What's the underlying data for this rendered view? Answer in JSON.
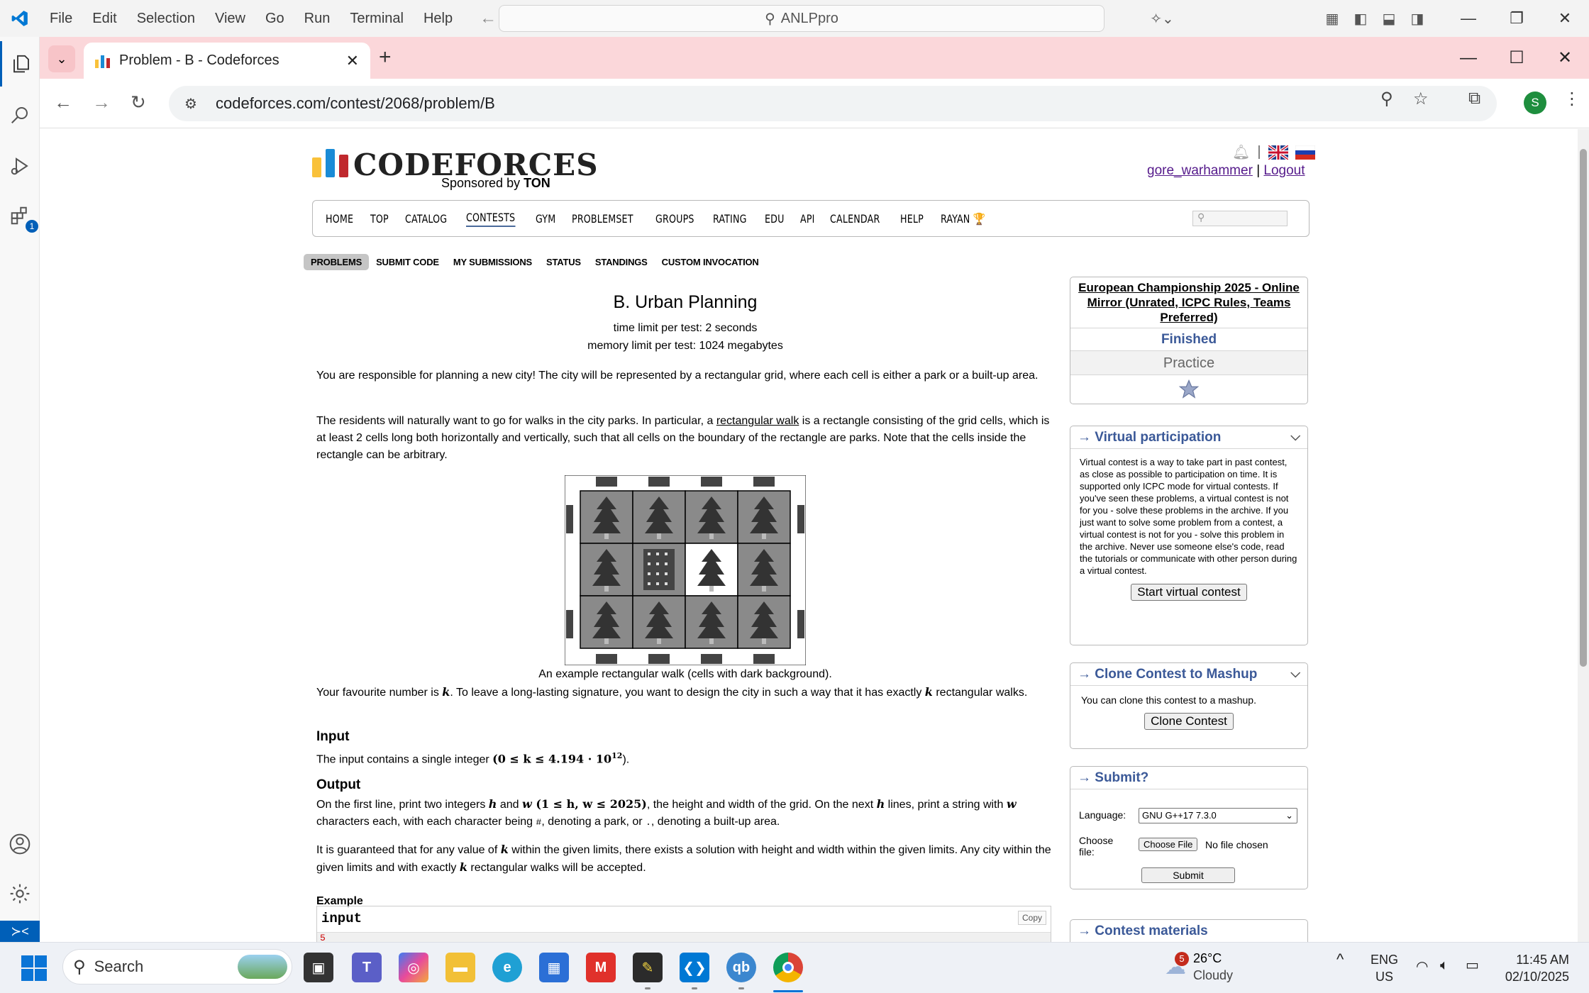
{
  "vscode": {
    "menu": [
      "File",
      "Edit",
      "Selection",
      "View",
      "Go",
      "Run",
      "Terminal",
      "Help"
    ],
    "search": "ANLPpro",
    "extensions_badge": "1"
  },
  "browser": {
    "tab_title": "Problem - B - Codeforces",
    "url": "codeforces.com/contest/2068/problem/B",
    "profile_initial": "S"
  },
  "site": {
    "logo_text": "CODEFORCES",
    "sponsor_prefix": "Sponsored by ",
    "sponsor_name": "TON",
    "username": "gore_warhammer",
    "separator": "|",
    "logout": "Logout",
    "nav": [
      "HOME",
      "TOP",
      "CATALOG",
      "CONTESTS",
      "GYM",
      "PROBLEMSET",
      "GROUPS",
      "RATING",
      "EDU",
      "API",
      "CALENDAR",
      "HELP",
      "RAYAN 🏆"
    ],
    "nav_selected": "CONTESTS",
    "subnav": [
      "PROBLEMS",
      "SUBMIT CODE",
      "MY SUBMISSIONS",
      "STATUS",
      "STANDINGS",
      "CUSTOM INVOCATION"
    ]
  },
  "problem": {
    "title": "B. Urban Planning",
    "time_limit": "time limit per test: 2 seconds",
    "memory_limit": "memory limit per test: 1024 megabytes",
    "p1": "You are responsible for planning a new city! The city will be represented by a rectangular grid, where each cell is either a park or a built-up area.",
    "p2_a": "The residents will naturally want to go for walks in the city parks. In particular, a ",
    "p2_link": "rectangular walk",
    "p2_b": " is a rectangle consisting of the grid cells, which is at least 2 cells long both horizontally and vertically, such that all cells on the boundary of the rectangle are parks. Note that the cells inside the rectangle can be arbitrary.",
    "caption": "An example rectangular walk (cells with dark background).",
    "p3_a": "Your favourite number is ",
    "p3_b": ". To leave a long-lasting signature, you want to design the city in such a way that it has exactly ",
    "p3_c": " rectangular walks.",
    "var_k": "k",
    "var_h": "h",
    "var_w": "w",
    "input_title": "Input",
    "input_a": "The input contains a single integer ",
    "input_math": "(0 ≤ k ≤ 4.194 · 10",
    "input_exp": "12",
    "input_end": ").",
    "output_title": "Output",
    "out_a": "On the first line, print two integers ",
    "out_and": " and ",
    "out_math": " (1 ≤ h, w ≤ 2025)",
    "out_b": ", the height and width of the grid. On the next ",
    "out_c": " lines, print a string with ",
    "out_d": "characters each, with each character being ",
    "out_hash": "#",
    "out_e": ", denoting a park, or ",
    "out_dot": ".",
    "out_f": ", denoting a built-up area.",
    "g_a": "It is guaranteed that for any value of ",
    "g_b": " within the given limits, there exists a solution with height and width within the given limits. Any city within the given limits and with exactly ",
    "g_c": " rectangular walks will be accepted.",
    "example": "Example",
    "input_label": "input",
    "copy": "Copy",
    "input_value": "5"
  },
  "sidebar": {
    "contest_name": "European Championship 2025 - Online Mirror (Unrated, ICPC Rules, Teams Preferred)",
    "status": "Finished",
    "mode": "Practice",
    "virtual_title": "→ Virtual participation",
    "virtual_text": "Virtual contest is a way to take part in past contest, as close as possible to participation on time. It is supported only ICPC mode for virtual contests. If you've seen these problems, a virtual contest is not for you - solve these problems in the archive. If you just want to solve some problem from a contest, a virtual contest is not for you - solve this problem in the archive. Never use someone else's code, read the tutorials or communicate with other person during a virtual contest.",
    "virtual_btn": "Start virtual contest",
    "clone_title": "→ Clone Contest to Mashup",
    "clone_text": "You can clone this contest to a mashup.",
    "clone_btn": "Clone Contest",
    "submit_title": "→ Submit?",
    "language_label": "Language:",
    "language_value": "GNU G++17 7.3.0",
    "file_label": "Choose file:",
    "choose_btn": "Choose File",
    "no_file": "No file chosen",
    "submit_btn": "Submit",
    "materials_title": "→ Contest materials"
  },
  "taskbar": {
    "search": "Search",
    "weather_temp": "26°C",
    "weather_desc": "Cloudy",
    "weather_badge": "5",
    "lang1": "ENG",
    "lang2": "US",
    "time": "11:45 AM",
    "date": "02/10/2025"
  }
}
